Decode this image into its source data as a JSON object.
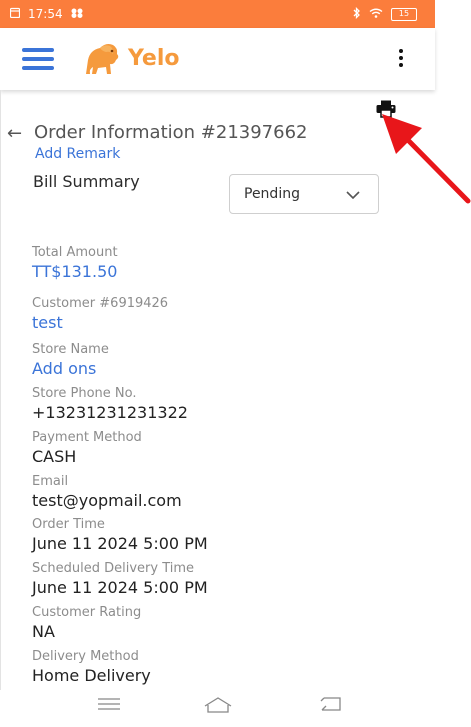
{
  "status_bar": {
    "time": "17:54",
    "battery": "15"
  },
  "app": {
    "brand": "Yelo"
  },
  "order": {
    "title": "Order Information #21397662",
    "back_symbol": "←",
    "add_remark": "Add Remark",
    "bill_summary": "Bill Summary",
    "status_selected": "Pending"
  },
  "fields": [
    {
      "label": "Total Amount",
      "value": "TT$131.50"
    },
    {
      "label": "Customer #6919426",
      "value": "test"
    },
    {
      "label": "Store Name",
      "value": "Add ons"
    },
    {
      "label": "Store Phone No.",
      "value": "+13231231231322"
    },
    {
      "label": "Payment Method",
      "value": "CASH"
    },
    {
      "label": "Email",
      "value": "test@yopmail.com"
    },
    {
      "label": "Order Time",
      "value": "June 11 2024 5:00 PM"
    },
    {
      "label": "Scheduled Delivery Time",
      "value": "June 11 2024 5:00 PM"
    },
    {
      "label": "Customer Rating",
      "value": "NA"
    },
    {
      "label": "Delivery Method",
      "value": "Home Delivery"
    }
  ],
  "colors": {
    "status_bar": "#fb7d3c",
    "accent_blue": "#3b74d8",
    "brand_orange": "#f59a3d",
    "annotation_red": "#e8161a"
  },
  "icons": [
    "menu-icon",
    "lion-logo",
    "more-vert-icon",
    "print-icon",
    "back-arrow-icon",
    "chevron-down-icon",
    "annotation-arrow",
    "nav-menu-icon",
    "nav-home-icon",
    "nav-back-icon"
  ]
}
